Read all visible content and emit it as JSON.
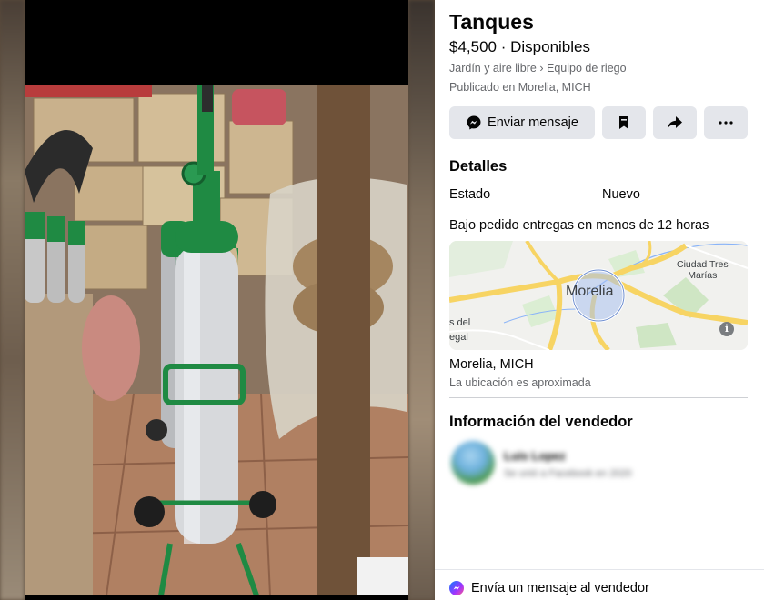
{
  "listing": {
    "title": "Tanques",
    "price_status": "$4,500 · Disponibles",
    "category": "Jardín y aire libre › Equipo de riego",
    "published": "Publicado en Morelia, MICH"
  },
  "actions": {
    "message_label": "Enviar mensaje",
    "icons": [
      "messenger-icon",
      "bookmark-icon",
      "share-icon",
      "more-icon"
    ]
  },
  "details": {
    "title": "Detalles",
    "condition_label": "Estado",
    "condition_value": "Nuevo",
    "description": "Bajo pedido entregas en menos de 12 horas"
  },
  "map": {
    "city": "Morelia",
    "town": "Ciudad Tres\nMarías",
    "edge_text_1": "s del",
    "edge_text_2": "egal",
    "info_glyph": "i"
  },
  "location": {
    "name": "Morelia, MICH",
    "note": "La ubicación es aproximada"
  },
  "seller": {
    "title": "Información del vendedor",
    "name": "Luis Lopez",
    "joined": "Se unió a Facebook en 2020"
  },
  "footer": {
    "message_prompt": "Envía un mensaje al vendedor"
  },
  "colors": {
    "button_bg": "#e4e6eb",
    "text_primary": "#050505",
    "text_secondary": "#65676b",
    "tank_green": "#1f8a43",
    "map_road": "#f7d463"
  }
}
